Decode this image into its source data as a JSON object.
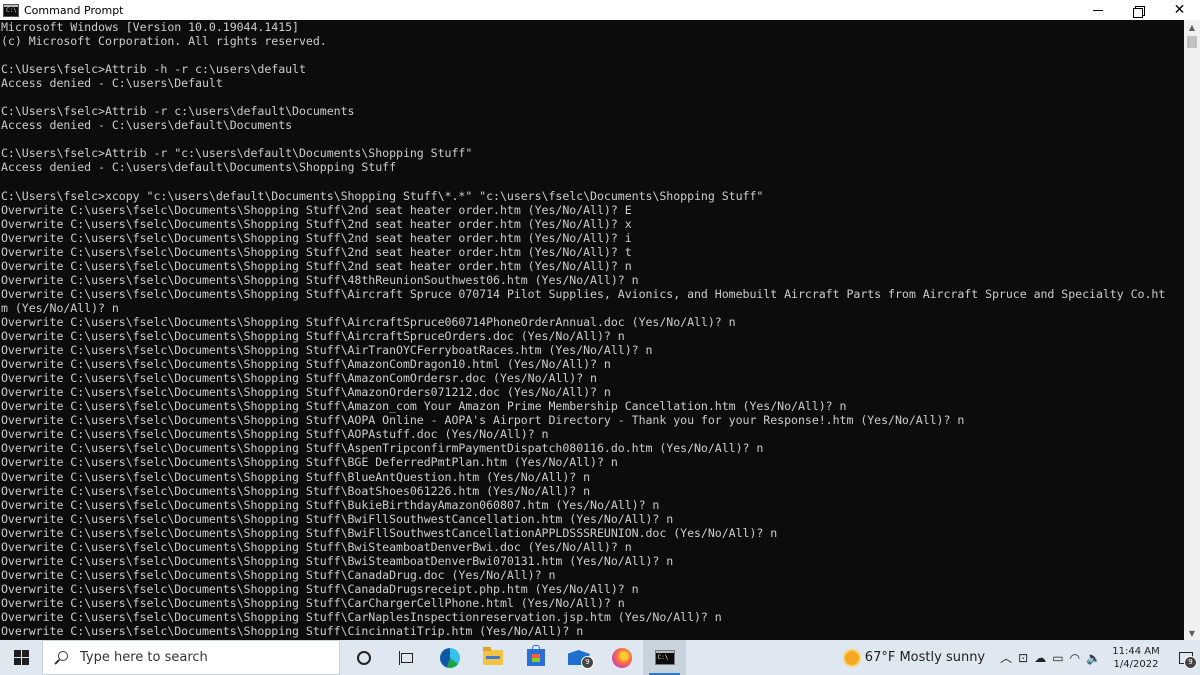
{
  "window": {
    "title": "Command Prompt",
    "icon_label": "C:\\"
  },
  "console": {
    "lines": [
      "Microsoft Windows [Version 10.0.19044.1415]",
      "(c) Microsoft Corporation. All rights reserved.",
      "",
      "C:\\Users\\fselc>Attrib -h -r c:\\users\\default",
      "Access denied - C:\\users\\Default",
      "",
      "C:\\Users\\fselc>Attrib -r c:\\users\\default\\Documents",
      "Access denied - C:\\users\\default\\Documents",
      "",
      "C:\\Users\\fselc>Attrib -r \"c:\\users\\default\\Documents\\Shopping Stuff\"",
      "Access denied - C:\\users\\default\\Documents\\Shopping Stuff",
      "",
      "C:\\Users\\fselc>xcopy \"c:\\users\\default\\Documents\\Shopping Stuff\\*.*\" \"c:\\users\\fselc\\Documents\\Shopping Stuff\"",
      "Overwrite C:\\users\\fselc\\Documents\\Shopping Stuff\\2nd seat heater order.htm (Yes/No/All)? E",
      "Overwrite C:\\users\\fselc\\Documents\\Shopping Stuff\\2nd seat heater order.htm (Yes/No/All)? x",
      "Overwrite C:\\users\\fselc\\Documents\\Shopping Stuff\\2nd seat heater order.htm (Yes/No/All)? i",
      "Overwrite C:\\users\\fselc\\Documents\\Shopping Stuff\\2nd seat heater order.htm (Yes/No/All)? t",
      "Overwrite C:\\users\\fselc\\Documents\\Shopping Stuff\\2nd seat heater order.htm (Yes/No/All)? n",
      "Overwrite C:\\users\\fselc\\Documents\\Shopping Stuff\\48thReunionSouthwest06.htm (Yes/No/All)? n",
      "Overwrite C:\\users\\fselc\\Documents\\Shopping Stuff\\Aircraft Spruce 070714 Pilot Supplies, Avionics, and Homebuilt Aircraft Parts from Aircraft Spruce and Specialty Co.ht",
      "m (Yes/No/All)? n",
      "Overwrite C:\\users\\fselc\\Documents\\Shopping Stuff\\AircraftSpruce060714PhoneOrderAnnual.doc (Yes/No/All)? n",
      "Overwrite C:\\users\\fselc\\Documents\\Shopping Stuff\\AircraftSpruceOrders.doc (Yes/No/All)? n",
      "Overwrite C:\\users\\fselc\\Documents\\Shopping Stuff\\AirTranOYCFerryboatRaces.htm (Yes/No/All)? n",
      "Overwrite C:\\users\\fselc\\Documents\\Shopping Stuff\\AmazonComDragon10.html (Yes/No/All)? n",
      "Overwrite C:\\users\\fselc\\Documents\\Shopping Stuff\\AmazonComOrdersr.doc (Yes/No/All)? n",
      "Overwrite C:\\users\\fselc\\Documents\\Shopping Stuff\\AmazonOrders071212.doc (Yes/No/All)? n",
      "Overwrite C:\\users\\fselc\\Documents\\Shopping Stuff\\Amazon_com Your Amazon Prime Membership Cancellation.htm (Yes/No/All)? n",
      "Overwrite C:\\users\\fselc\\Documents\\Shopping Stuff\\AOPA Online - AOPA's Airport Directory - Thank you for your Response!.htm (Yes/No/All)? n",
      "Overwrite C:\\users\\fselc\\Documents\\Shopping Stuff\\AOPAstuff.doc (Yes/No/All)? n",
      "Overwrite C:\\users\\fselc\\Documents\\Shopping Stuff\\AspenTripconfirmPaymentDispatch080116.do.htm (Yes/No/All)? n",
      "Overwrite C:\\users\\fselc\\Documents\\Shopping Stuff\\BGE DeferredPmtPlan.htm (Yes/No/All)? n",
      "Overwrite C:\\users\\fselc\\Documents\\Shopping Stuff\\BlueAntQuestion.htm (Yes/No/All)? n",
      "Overwrite C:\\users\\fselc\\Documents\\Shopping Stuff\\BoatShoes061226.htm (Yes/No/All)? n",
      "Overwrite C:\\users\\fselc\\Documents\\Shopping Stuff\\BukieBirthdayAmazon060807.htm (Yes/No/All)? n",
      "Overwrite C:\\users\\fselc\\Documents\\Shopping Stuff\\BwiFllSouthwestCancellation.htm (Yes/No/All)? n",
      "Overwrite C:\\users\\fselc\\Documents\\Shopping Stuff\\BwiFllSouthwestCancellationAPPLDSSSREUNION.doc (Yes/No/All)? n",
      "Overwrite C:\\users\\fselc\\Documents\\Shopping Stuff\\BwiSteamboatDenverBwi.doc (Yes/No/All)? n",
      "Overwrite C:\\users\\fselc\\Documents\\Shopping Stuff\\BwiSteamboatDenverBwi070131.htm (Yes/No/All)? n",
      "Overwrite C:\\users\\fselc\\Documents\\Shopping Stuff\\CanadaDrug.doc (Yes/No/All)? n",
      "Overwrite C:\\users\\fselc\\Documents\\Shopping Stuff\\CanadaDrugsreceipt.php.htm (Yes/No/All)? n",
      "Overwrite C:\\users\\fselc\\Documents\\Shopping Stuff\\CarChargerCellPhone.html (Yes/No/All)? n",
      "Overwrite C:\\users\\fselc\\Documents\\Shopping Stuff\\CarNaplesInspectionreservation.jsp.htm (Yes/No/All)? n",
      "Overwrite C:\\users\\fselc\\Documents\\Shopping Stuff\\CincinnatiTrip.htm (Yes/No/All)? n"
    ]
  },
  "taskbar": {
    "search_placeholder": "Type here to search",
    "mail_badge": "9",
    "weather_temp": "67°F",
    "weather_desc": "Mostly sunny",
    "time": "11:44 AM",
    "date": "1/4/2022",
    "notification_badge": "9",
    "apps": [
      "cortana-icon",
      "task-view-icon",
      "edge-icon",
      "file-explorer-icon",
      "store-icon",
      "mail-icon",
      "firefox-icon",
      "command-prompt-icon"
    ]
  },
  "colors": {
    "console_bg": "#0c0c0c",
    "console_text": "#cccccc",
    "taskbar_bg": "#dfe8f0"
  }
}
